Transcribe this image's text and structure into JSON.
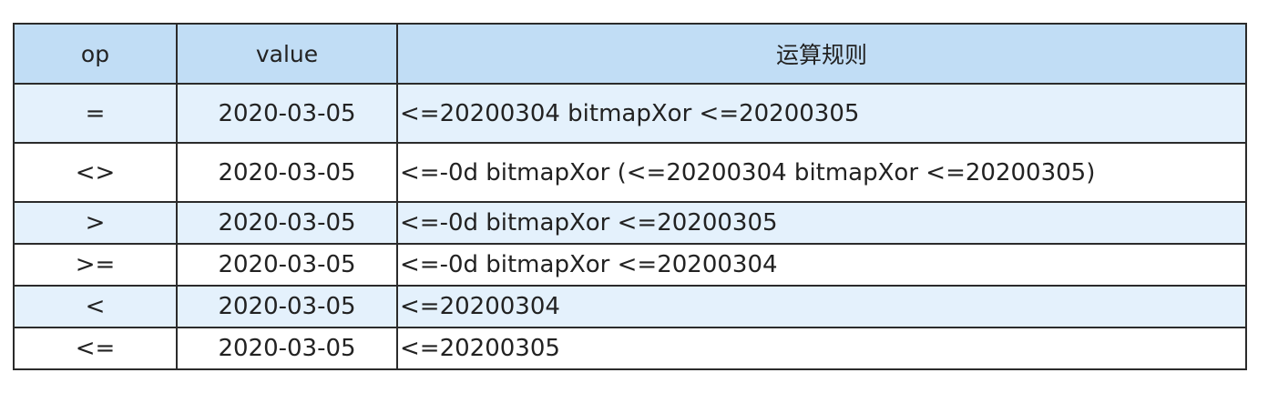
{
  "table": {
    "headers": {
      "op": "op",
      "value": "value",
      "rule": "运算规则"
    },
    "rows": [
      {
        "op": "=",
        "value": "2020-03-05",
        "rule": "<=20200304 bitmapXor <=20200305"
      },
      {
        "op": "<>",
        "value": "2020-03-05",
        "rule": "<=-0d bitmapXor (<=20200304 bitmapXor <=20200305)"
      },
      {
        "op": ">",
        "value": "2020-03-05",
        "rule": "<=-0d bitmapXor <=20200305"
      },
      {
        "op": ">=",
        "value": "2020-03-05",
        "rule": "<=-0d bitmapXor <=20200304"
      },
      {
        "op": "<",
        "value": "2020-03-05",
        "rule": "<=20200304"
      },
      {
        "op": "<=",
        "value": "2020-03-05",
        "rule": "<=20200305"
      }
    ]
  },
  "colors": {
    "header_bg": "#c1ddf5",
    "row_shade_bg": "#e4f1fc",
    "border": "#2b2b2b"
  }
}
